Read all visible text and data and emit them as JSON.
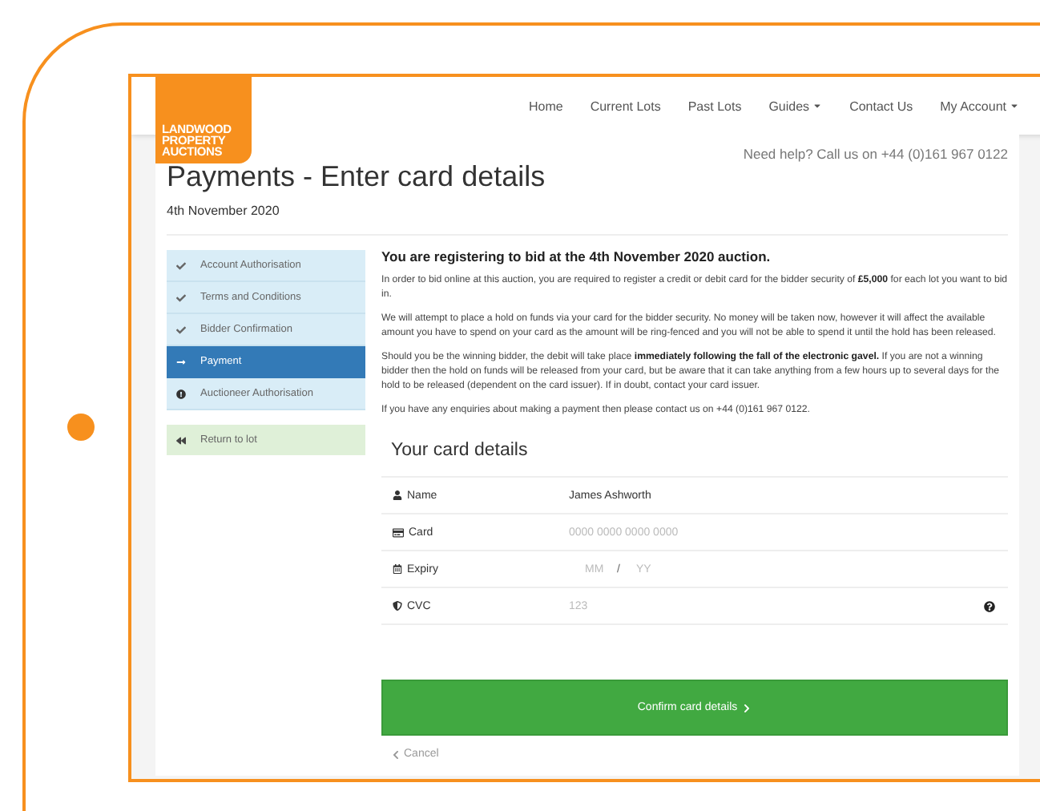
{
  "logo": {
    "lines": [
      "LANDWOOD",
      "PROPERTY",
      "AUCTIONS"
    ]
  },
  "nav": [
    {
      "label": "Home",
      "dropdown": false
    },
    {
      "label": "Current Lots",
      "dropdown": false
    },
    {
      "label": "Past Lots",
      "dropdown": false
    },
    {
      "label": "Guides",
      "dropdown": true
    },
    {
      "label": "Contact Us",
      "dropdown": false
    },
    {
      "label": "My Account",
      "dropdown": true
    }
  ],
  "help": "Need help? Call us on +44 (0)161 967 0122",
  "title": "Payments - Enter card details",
  "date": "4th November 2020",
  "steps": [
    {
      "label": "Account Authorisation",
      "kind": "done",
      "selected": false
    },
    {
      "label": "Terms and Conditions",
      "kind": "done",
      "selected": false
    },
    {
      "label": "Bidder Confirmation",
      "kind": "done",
      "selected": false
    },
    {
      "label": "Payment",
      "kind": "current",
      "selected": true
    },
    {
      "label": "Auctioneer Authorisation",
      "kind": "pending",
      "selected": false
    }
  ],
  "return_link": "Return to lot",
  "heading": "You are registering to bid at the 4th November 2020 auction.",
  "paragraphs": [
    "In order to bid online at this auction, you are required to register a credit or debit card for the bidder security of **£5,000** for each lot you want to bid in.",
    "We will attempt to place a hold on funds via your card for the bidder security. No money will be taken now, however it will affect the available amount you have to spend on your card as the amount will be ring-fenced and you will not be able to spend it until the hold has been released.",
    "Should you be the winning bidder, the debit will take place **immediately following the fall of the electronic gavel.** If you are not a winning bidder then the hold on funds will be released from your card, but be aware that it can take anything from a few hours up to several days for the hold to be released (dependent on the card issuer). If in doubt, contact your card issuer.",
    "If you have any enquiries about making a payment then please contact us on +44 (0)161 967 0122."
  ],
  "card_heading": "Your card details",
  "fields": [
    {
      "kind": "name",
      "label": "Name",
      "value": "James Ashworth"
    },
    {
      "kind": "card",
      "label": "Card",
      "placeholder": "0000 0000 0000 0000"
    },
    {
      "kind": "expiry",
      "label": "Expiry",
      "month_placeholder": "MM",
      "separator": "/",
      "year_placeholder": "YY"
    },
    {
      "kind": "cvc",
      "label": "CVC",
      "placeholder": "123",
      "help": true
    }
  ],
  "confirm_button": "Confirm card details",
  "cancel_link": "Cancel"
}
